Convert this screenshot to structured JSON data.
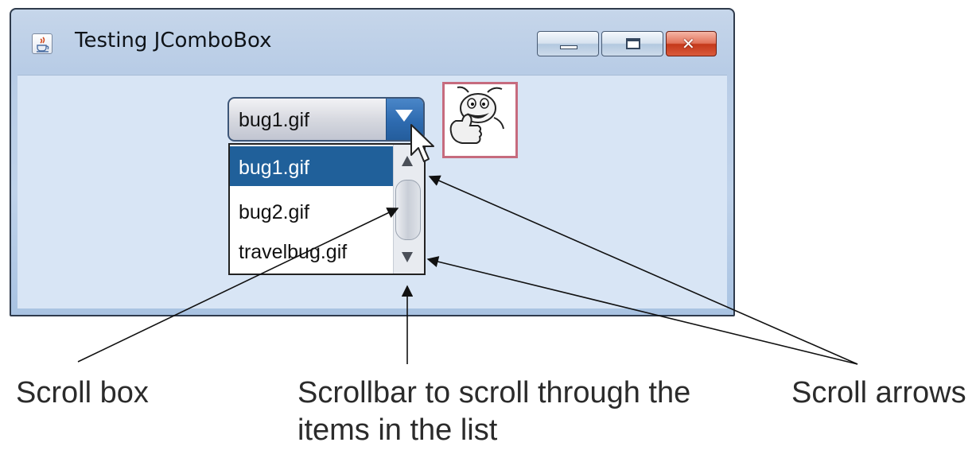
{
  "window": {
    "title": "Testing JComboBox",
    "icon": "java-cup-icon",
    "buttons": {
      "minimize": "minimize-icon",
      "maximize": "maximize-icon",
      "close": "close-icon"
    }
  },
  "combo": {
    "selected": "bug1.gif",
    "items": [
      "bug1.gif",
      "bug2.gif",
      "travelbug.gif"
    ],
    "highlight_color": "#20609a"
  },
  "image_label": {
    "icon": "bug-thumbs-up-icon"
  },
  "callouts": {
    "scroll_box": "Scroll box",
    "scrollbar_line1": "Scrollbar to scroll through the",
    "scrollbar_line2": "items in the list",
    "scroll_arrows": "Scroll arrows"
  }
}
